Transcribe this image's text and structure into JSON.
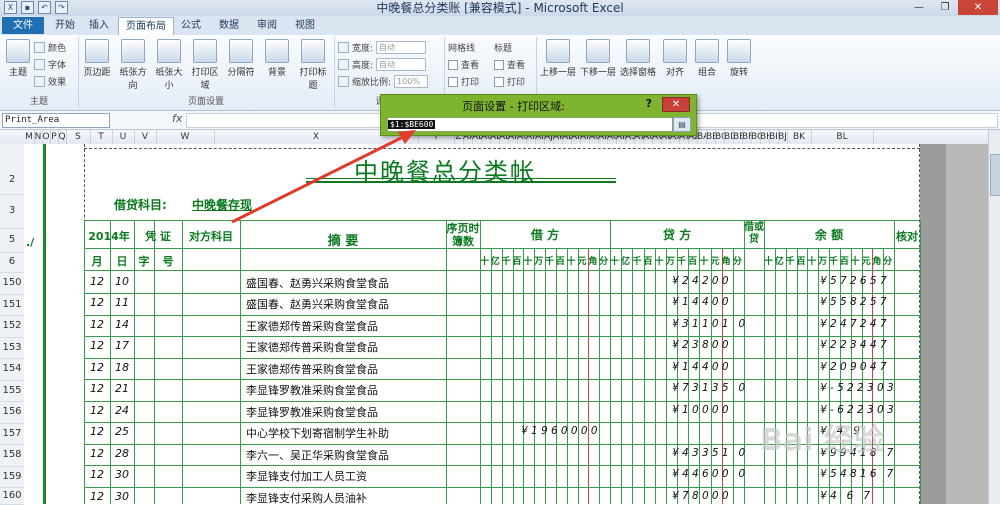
{
  "window": {
    "title": "中晚餐总分类账  [兼容模式] - Microsoft Excel",
    "buttons": [
      "—",
      "❐",
      "✕"
    ]
  },
  "tabs": [
    "文件",
    "开始",
    "插入",
    "页面布局",
    "公式",
    "数据",
    "审阅",
    "视图"
  ],
  "active_tab": "页面布局",
  "ribbon": {
    "theme_group": {
      "label": "主题",
      "big": "主题",
      "colors": "颜色",
      "fonts": "字体",
      "effects": "效果"
    },
    "page_setup_group": {
      "label": "页面设置",
      "buttons": [
        "页边距",
        "纸张方向",
        "纸张大小",
        "打印区域",
        "分隔符",
        "背景",
        "打印标题"
      ]
    },
    "scale_group": {
      "label": "调整为",
      "width_label": "宽度:",
      "width_value": "自动",
      "height_label": "高度:",
      "height_value": "自动",
      "scale_label": "缩放比例:",
      "scale_value": "100%"
    },
    "sheet_options_group": {
      "gridlines": "网格线",
      "headings": "标题",
      "view": "查看",
      "print": "打印"
    },
    "arrange_group": {
      "buttons": [
        "上移一层",
        "下移一层",
        "选择窗格",
        "对齐",
        "组合",
        "旋转"
      ]
    }
  },
  "formula_bar": {
    "name_box": "Print_Area",
    "fx": "fx",
    "value": ""
  },
  "dialog": {
    "title": "页面设置 - 打印区域:",
    "help": "?",
    "close": "✕",
    "value": "$1:$BE600",
    "collapse_icon": "collapse-icon"
  },
  "sheet": {
    "title": "中晚餐总分类帐",
    "subject_label": "借贷科目:",
    "subject_value": "中晚餐存现",
    "header": {
      "year": "2014年",
      "month": "月",
      "day": "日",
      "voucher": "凭  证",
      "zi": "字",
      "hao": "号",
      "counter_account": "对方科目",
      "summary": "摘          要",
      "page_no": "序页时簿数",
      "debit": "借          方",
      "credit": "贷          方",
      "dc": "借或贷",
      "balance": "余          额",
      "check": "核对",
      "digit_units": "十亿千百十万千百十元角分"
    },
    "columns": [
      "M",
      "N",
      "O",
      "P",
      "Q",
      "S",
      "T",
      "U",
      "V",
      "W",
      "X",
      "Y",
      "Z",
      "AA",
      "AB",
      "AC",
      "AD",
      "AE",
      "AF",
      "AG",
      "AH",
      "AI",
      "AJ",
      "AK",
      "AL",
      "AM",
      "AN",
      "AO",
      "AP",
      "AQ",
      "AR",
      "AS",
      "AT",
      "AU",
      "AV",
      "AW",
      "AX",
      "AY",
      "AZ",
      "BA",
      "BB",
      "BC",
      "BD",
      "BE",
      "BF",
      "BG",
      "BH",
      "BI",
      "BJ",
      "BK",
      "BL"
    ],
    "row_headers": [
      "2",
      "3",
      "5",
      "6",
      "150",
      "151",
      "152",
      "153",
      "154",
      "155",
      "156",
      "157",
      "158",
      "159",
      "160"
    ],
    "row5_mark": "./",
    "rows": [
      {
        "row": "150",
        "month": "12",
        "day": "10",
        "summary": "盛国春、赵勇兴采购食堂食品",
        "debit": "",
        "credit": "¥24200",
        "balance": "¥572657"
      },
      {
        "row": "151",
        "month": "12",
        "day": "11",
        "summary": "盛国春、赵勇兴采购食堂食品",
        "debit": "",
        "credit": "¥14400",
        "balance": "¥558257"
      },
      {
        "row": "152",
        "month": "12",
        "day": "14",
        "summary": "王家德郑传普采购食堂食品",
        "debit": "",
        "credit": "¥31101 0",
        "balance": "¥247247"
      },
      {
        "row": "153",
        "month": "12",
        "day": "17",
        "summary": "王家德郑传普采购食堂食品",
        "debit": "",
        "credit": "¥23800",
        "balance": "¥223447"
      },
      {
        "row": "154",
        "month": "12",
        "day": "18",
        "summary": "王家德郑传普采购食堂食品",
        "debit": "",
        "credit": "¥14400",
        "balance": "¥209047"
      },
      {
        "row": "155",
        "month": "12",
        "day": "21",
        "summary": "李显锋罗教准采购食堂食品",
        "debit": "",
        "credit": "¥73135 0",
        "balance": "¥-522303"
      },
      {
        "row": "156",
        "month": "12",
        "day": "24",
        "summary": "李显锋罗教准采购食堂食品",
        "debit": "",
        "credit": "¥10000",
        "balance": "¥-622303"
      },
      {
        "row": "157",
        "month": "12",
        "day": "25",
        "summary": "中心学校下划寄宿制学生补助",
        "debit": "¥1960000",
        "credit": "",
        "balance": "¥  4   9"
      },
      {
        "row": "158",
        "month": "12",
        "day": "28",
        "summary": "李六一、吴正华采购食堂食品",
        "debit": "",
        "credit": "¥43351 0",
        "balance": "¥99418 7"
      },
      {
        "row": "159",
        "month": "12",
        "day": "30",
        "summary": "李显锋支付加工人员工资",
        "debit": "",
        "credit": "¥44600 0",
        "balance": "¥54816 7"
      },
      {
        "row": "160",
        "month": "12",
        "day": "30",
        "summary": "李显锋支付采购人员油补",
        "debit": "",
        "credit": "¥78000",
        "balance": "¥4  6   7"
      }
    ]
  },
  "watermark": "Bai 经验"
}
